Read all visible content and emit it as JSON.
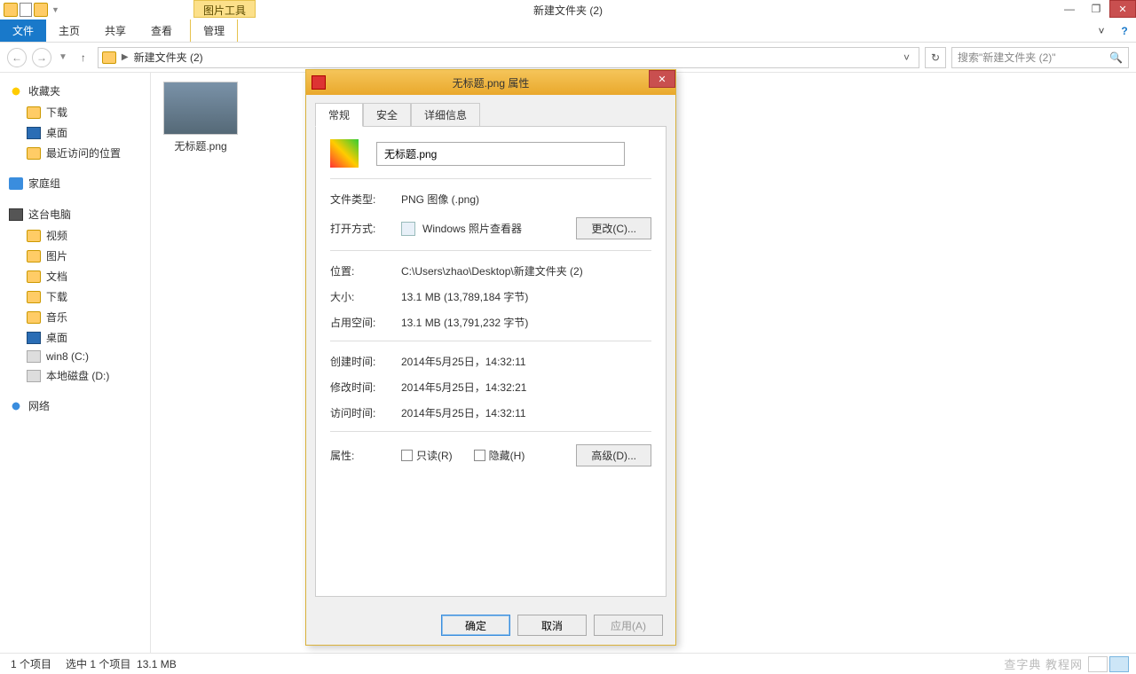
{
  "titlebar": {
    "context_tab": "图片工具",
    "window_title": "新建文件夹 (2)"
  },
  "ribbon": {
    "file": "文件",
    "tabs": [
      "主页",
      "共享",
      "查看"
    ],
    "context_group": "管理"
  },
  "nav": {
    "breadcrumb": "新建文件夹 (2)",
    "search_placeholder": "搜索\"新建文件夹 (2)\""
  },
  "sidebar": {
    "favorites": {
      "title": "收藏夹",
      "items": [
        "下载",
        "桌面",
        "最近访问的位置"
      ]
    },
    "homegroup": {
      "title": "家庭组"
    },
    "computer": {
      "title": "这台电脑",
      "items": [
        "视频",
        "图片",
        "文档",
        "下载",
        "音乐",
        "桌面",
        "win8 (C:)",
        "本地磁盘 (D:)"
      ]
    },
    "network": {
      "title": "网络"
    }
  },
  "content": {
    "file_name": "无标题.png"
  },
  "statusbar": {
    "count": "1 个项目",
    "selected": "选中 1 个项目",
    "size": "13.1 MB",
    "watermark": "查字典 教程网"
  },
  "dialog": {
    "title": "无标题.png 属性",
    "tabs": [
      "常规",
      "安全",
      "详细信息"
    ],
    "file_name": "无标题.png",
    "rows": {
      "type_label": "文件类型:",
      "type_value": "PNG 图像 (.png)",
      "open_label": "打开方式:",
      "open_value": "Windows 照片查看器",
      "change_btn": "更改(C)...",
      "location_label": "位置:",
      "location_value": "C:\\Users\\zhao\\Desktop\\新建文件夹 (2)",
      "size_label": "大小:",
      "size_value": "13.1 MB (13,789,184 字节)",
      "disk_label": "占用空间:",
      "disk_value": "13.1 MB (13,791,232 字节)",
      "created_label": "创建时间:",
      "created_value": "2014年5月25日，14:32:11",
      "modified_label": "修改时间:",
      "modified_value": "2014年5月25日，14:32:21",
      "accessed_label": "访问时间:",
      "accessed_value": "2014年5月25日，14:32:11",
      "attrs_label": "属性:",
      "readonly": "只读(R)",
      "hidden": "隐藏(H)",
      "advanced_btn": "高级(D)..."
    },
    "buttons": {
      "ok": "确定",
      "cancel": "取消",
      "apply": "应用(A)"
    }
  }
}
